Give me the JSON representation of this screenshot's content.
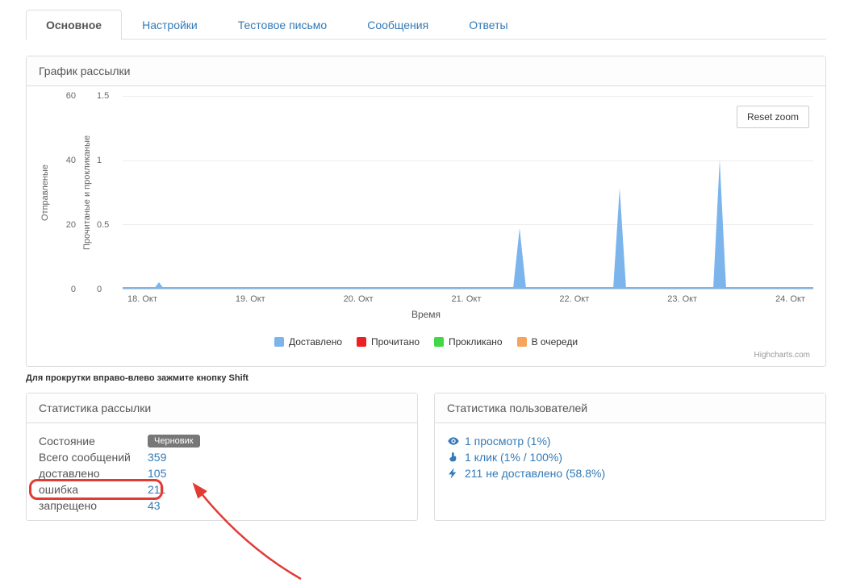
{
  "tabs": {
    "main": "Основное",
    "settings": "Настройки",
    "test_mail": "Тестовое письмо",
    "messages": "Сообщения",
    "replies": "Ответы"
  },
  "chart_panel": {
    "title": "График рассылки",
    "reset_zoom": "Reset zoom",
    "y_left_label": "Отправленые",
    "y_right_label": "Прочитаные и прокликаные",
    "x_label": "Время",
    "credits": "Highcharts.com",
    "hint": "Для прокрутки вправо-влево зажмите кнопку Shift",
    "legend": {
      "delivered": "Доставлено",
      "read": "Прочитано",
      "clicked": "Прокликано",
      "queued": "В очереди"
    },
    "y_left_ticks": {
      "t0": "0",
      "t1": "20",
      "t2": "40",
      "t3": "60"
    },
    "y_right_ticks": {
      "t0": "0",
      "t1": "0.5",
      "t2": "1",
      "t3": "1.5"
    },
    "x_ticks": {
      "d18": "18. Окт",
      "d19": "19. Окт",
      "d20": "20. Окт",
      "d21": "21. Окт",
      "d22": "22. Окт",
      "d23": "23. Окт",
      "d24": "24. Окт"
    }
  },
  "chart_data": {
    "type": "line",
    "xlabel": "Время",
    "ylabel_left": "Отправленые",
    "ylabel_right": "Прочитаные и прокликаные",
    "ylim_left": [
      0,
      60
    ],
    "ylim_right": [
      0,
      1.5
    ],
    "x": [
      "18. Окт",
      "19. Окт",
      "20. Окт",
      "21. Окт",
      "22. Окт",
      "23. Окт",
      "24. Окт"
    ],
    "series": [
      {
        "name": "Доставлено",
        "axis": "left",
        "color": "#7cb5ec",
        "values": [
          2,
          0,
          0,
          0,
          0,
          0,
          0
        ]
      },
      {
        "name": "Прочитано",
        "axis": "right",
        "color": "#ed2024",
        "values": [
          0,
          0,
          0,
          0,
          0,
          0,
          0
        ]
      },
      {
        "name": "Прокликано",
        "axis": "right",
        "color": "#41d745",
        "values": [
          0,
          0,
          0,
          0,
          0,
          0,
          0
        ]
      },
      {
        "name": "В очереди",
        "axis": "left",
        "color": "#f7a35c",
        "values": [
          0,
          0,
          0,
          0,
          0,
          0,
          0
        ]
      }
    ],
    "spike_events": [
      {
        "x_fraction": 0.565,
        "height_right": 0.47
      },
      {
        "x_fraction": 0.71,
        "height_right": 0.78
      },
      {
        "x_fraction": 0.855,
        "height_right": 1.0
      }
    ]
  },
  "stats_panel": {
    "title": "Статистика рассылки",
    "rows": {
      "state_label": "Состояние",
      "state_badge": "Черновик",
      "total_label": "Всего сообщений",
      "total_value": "359",
      "delivered_label": "доставлено",
      "delivered_value": "105",
      "error_label": "ошибка",
      "error_value": "211",
      "blocked_label": "запрещено",
      "blocked_value": "43"
    }
  },
  "users_panel": {
    "title": "Статистика пользователей",
    "views": "1 просмотр (1%)",
    "clicks": "1 клик (1% / 100%)",
    "undelivered": "211 не доставлено (58.8%)"
  }
}
